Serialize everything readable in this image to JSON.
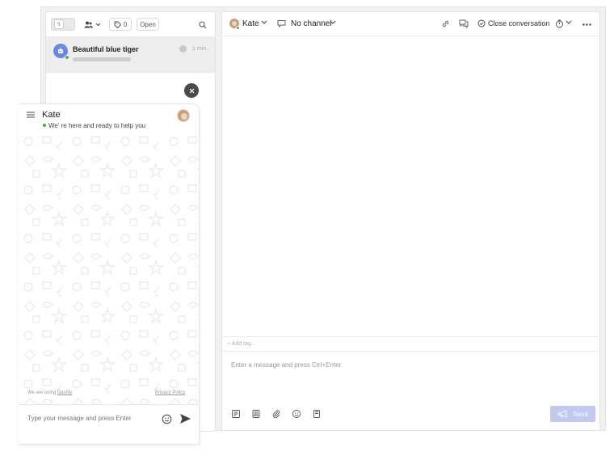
{
  "list_toolbar": {
    "tag_count": "0",
    "open_label": "Open"
  },
  "conversation_list": {
    "items": [
      {
        "name": "Beautiful blue tiger",
        "time": "1 min.."
      }
    ]
  },
  "conversation_header": {
    "agent_name": "Kate",
    "channel_label": "No channel",
    "close_label": "Close conversation"
  },
  "composer": {
    "add_tag_label": "+ Add tag...",
    "placeholder": "Enter a message and press Ctrl+Enter",
    "send_label": "Send"
  },
  "widget": {
    "agent_name": "Kate",
    "status_text": "We' re here and ready to help you",
    "powered_prefix": "We are using",
    "powered_brand": "Dashly",
    "privacy_label": "Privacy Policy",
    "input_placeholder": "Type your message and press Enter"
  },
  "colors": {
    "accent": "#6c87e0",
    "online": "#3fb24a",
    "send_disabled": "#c2c8ef"
  }
}
